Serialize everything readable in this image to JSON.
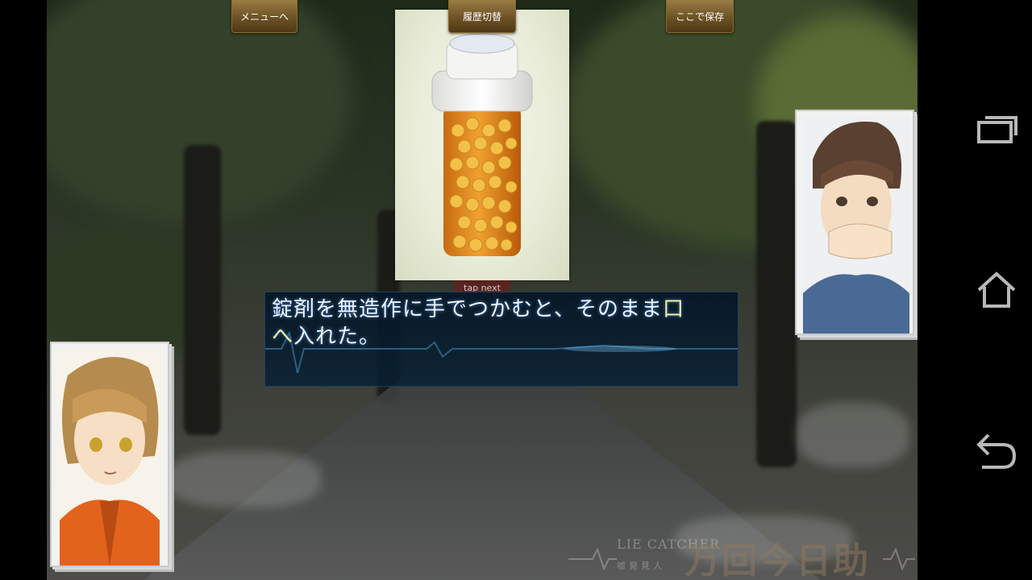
{
  "toolbar": {
    "menu_label": "メニューへ",
    "history_label": "履歴切替",
    "save_label": "ここで保存"
  },
  "message": {
    "tap_next": "tap next",
    "line1_main": "錠剤を無造作に手でつかむと、そのまま",
    "line1_highlight": "口",
    "line2_highlight": "へ",
    "line2_main": "入れた。"
  },
  "logo": {
    "english": "LIE CATCHER",
    "subtitle": "嘘発見人",
    "title": "万回今日助"
  },
  "navigation": {
    "icons": [
      "recent-apps-icon",
      "home-icon",
      "back-icon"
    ]
  },
  "colors": {
    "highlight": "#f8f2a0",
    "button_gold": "#6c5226",
    "message_bg": "#081f33"
  }
}
